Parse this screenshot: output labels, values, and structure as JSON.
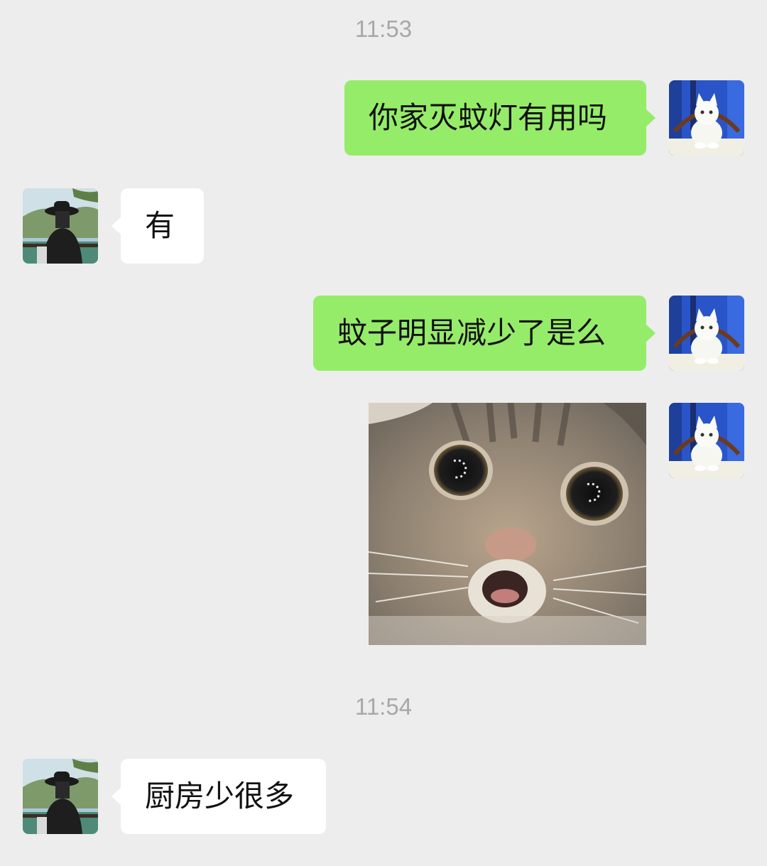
{
  "chat": {
    "timestamps": [
      "11:53",
      "11:54"
    ],
    "messages": [
      {
        "sender": "me",
        "type": "text",
        "text": "你家灭蚊灯有用吗"
      },
      {
        "sender": "friend",
        "type": "text",
        "text": "有"
      },
      {
        "sender": "me",
        "type": "text",
        "text": "蚊子明显减少了是么"
      },
      {
        "sender": "me",
        "type": "sticker",
        "sticker": "surprised-cat"
      },
      {
        "sender": "friend",
        "type": "text",
        "text": "厨房少很多"
      }
    ],
    "avatars": {
      "me": "white-cat-avatar",
      "friend": "person-in-hat-avatar"
    }
  },
  "colors": {
    "background": "#ededed",
    "outgoing_bubble": "#95ec69",
    "incoming_bubble": "#ffffff",
    "timestamp_text": "#a8a8a8"
  }
}
